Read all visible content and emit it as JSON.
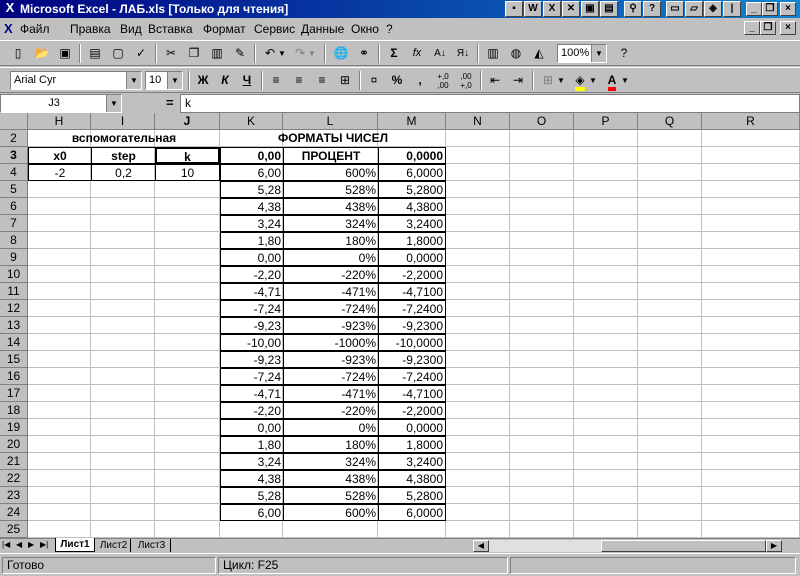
{
  "window": {
    "title": "Microsoft Excel - ЛАБ.xls  [Только для чтения]"
  },
  "menu": [
    "Файл",
    "Правка",
    "Вид",
    "Вставка",
    "Формат",
    "Сервис",
    "Данные",
    "Окно",
    "?"
  ],
  "toolbar": {
    "zoom": "100%",
    "font": "Arial Cyr",
    "font_size": "10",
    "bold": "Ж",
    "italic": "К",
    "underline": "Ч",
    "percent": "%",
    "thousands": ",",
    "inc_decimal": "+,0 ,00",
    "dec_decimal": ",00 +,0",
    "sum": "Σ",
    "function": "fx"
  },
  "formula_bar": {
    "name_box": "J3",
    "equals": "=",
    "content": "k"
  },
  "columns": [
    "H",
    "I",
    "J",
    "K",
    "L",
    "M",
    "N",
    "O",
    "P",
    "Q",
    "R"
  ],
  "selected_column": "J",
  "rows": [
    "2",
    "3",
    "4",
    "5",
    "6",
    "7",
    "8",
    "9",
    "10",
    "11",
    "12",
    "13",
    "14",
    "15",
    "16",
    "17",
    "18",
    "19",
    "20",
    "21",
    "22",
    "23",
    "24",
    "25"
  ],
  "selected_row": "3",
  "sheet": {
    "helper_title": "вспомогательная",
    "formats_title": "ФОРМАТЫ ЧИСЕЛ",
    "headers": {
      "h": "x0",
      "i": "step",
      "j": "k",
      "k": "0,00",
      "l": "ПРОЦЕНТ",
      "m": "0,0000"
    },
    "params": {
      "x0": "-2",
      "step": "0,2",
      "k": "10"
    },
    "col_k": [
      "6,00",
      "5,28",
      "4,38",
      "3,24",
      "1,80",
      "0,00",
      "-2,20",
      "-4,71",
      "-7,24",
      "-9,23",
      "-10,00",
      "-9,23",
      "-7,24",
      "-4,71",
      "-2,20",
      "0,00",
      "1,80",
      "3,24",
      "4,38",
      "5,28",
      "6,00"
    ],
    "col_l": [
      "600%",
      "528%",
      "438%",
      "324%",
      "180%",
      "0%",
      "-220%",
      "-471%",
      "-724%",
      "-923%",
      "-1000%",
      "-923%",
      "-724%",
      "-471%",
      "-220%",
      "0%",
      "180%",
      "324%",
      "438%",
      "528%",
      "600%"
    ],
    "col_m": [
      "6,0000",
      "5,2800",
      "4,3800",
      "3,2400",
      "1,8000",
      "0,0000",
      "-2,2000",
      "-4,7100",
      "-7,2400",
      "-9,2300",
      "-10,0000",
      "-9,2300",
      "-7,2400",
      "-4,7100",
      "-2,2000",
      "0,0000",
      "1,8000",
      "3,2400",
      "4,3800",
      "5,2800",
      "6,0000"
    ]
  },
  "tabs": [
    "Лист1",
    "Лист2",
    "Лист3"
  ],
  "active_tab": "Лист1",
  "status": {
    "ready": "Готово",
    "cycle": "Цикл: F25"
  }
}
